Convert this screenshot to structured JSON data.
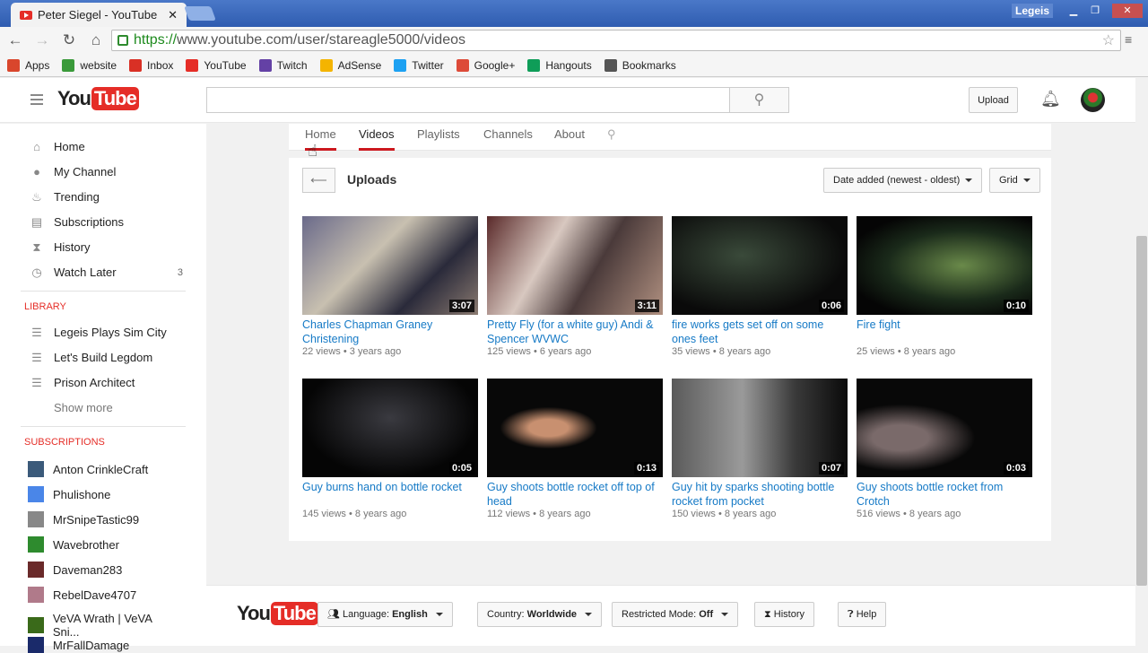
{
  "browser": {
    "tab_title": "Peter Siegel - YouTube",
    "tab_close": "✕",
    "user": "Legeis",
    "url_https": "https://",
    "url_rest": "www.youtube.com/user/stareagle5000/videos",
    "bookmarks": [
      {
        "label": "Apps",
        "icon": "apps-icon",
        "color": "#d9462c"
      },
      {
        "label": "website",
        "icon": "website-icon",
        "color": "#3a9a3a"
      },
      {
        "label": "Inbox",
        "icon": "gmail-icon",
        "color": "#d93025"
      },
      {
        "label": "YouTube",
        "icon": "youtube-icon",
        "color": "#e52d27"
      },
      {
        "label": "Twitch",
        "icon": "twitch-icon",
        "color": "#6441a5"
      },
      {
        "label": "AdSense",
        "icon": "adsense-icon",
        "color": "#f4b400"
      },
      {
        "label": "Twitter",
        "icon": "twitter-icon",
        "color": "#1da1f2"
      },
      {
        "label": "Google+",
        "icon": "googleplus-icon",
        "color": "#dd4b39"
      },
      {
        "label": "Hangouts",
        "icon": "hangouts-icon",
        "color": "#0f9d58"
      },
      {
        "label": "Bookmarks",
        "icon": "star-icon",
        "color": "#555555"
      }
    ]
  },
  "masthead": {
    "logo_you": "You",
    "logo_tube": "Tube",
    "upload": "Upload"
  },
  "sidebar": {
    "nav": [
      {
        "label": "Home",
        "icon": "home-icon",
        "glyph": "⌂"
      },
      {
        "label": "My Channel",
        "icon": "person-icon",
        "glyph": "●"
      },
      {
        "label": "Trending",
        "icon": "flame-icon",
        "glyph": "♨"
      },
      {
        "label": "Subscriptions",
        "icon": "subscriptions-icon",
        "glyph": "▤"
      },
      {
        "label": "History",
        "icon": "hourglass-icon",
        "glyph": "⧗"
      },
      {
        "label": "Watch Later",
        "icon": "clock-icon",
        "glyph": "◷",
        "count": "3"
      }
    ],
    "library_heading": "LIBRARY",
    "library": [
      {
        "label": "Legeis Plays Sim City"
      },
      {
        "label": "Let's Build Legdom"
      },
      {
        "label": "Prison Architect"
      }
    ],
    "show_more": "Show more",
    "subscriptions_heading": "SUBSCRIPTIONS",
    "subscriptions": [
      {
        "label": "Anton CrinkleCraft",
        "color": "#3b5a7a"
      },
      {
        "label": "Phulishone",
        "color": "#4a86e8"
      },
      {
        "label": "MrSnipeTastic99",
        "color": "#888888"
      },
      {
        "label": "Wavebrother",
        "color": "#2e8b2e"
      },
      {
        "label": "Daveman283",
        "color": "#6a2a2a"
      },
      {
        "label": "RebelDave4707",
        "color": "#b07a8a"
      },
      {
        "label": "VeVA Wrath | VeVA Sni...",
        "color": "#3a6a1a"
      },
      {
        "label": "MrFallDamage",
        "color": "#1a2a6a"
      }
    ]
  },
  "channel_tabs": [
    "Home",
    "Videos",
    "Playlists",
    "Channels",
    "About"
  ],
  "uploads": {
    "title": "Uploads",
    "sort": "Date added (newest - oldest)",
    "view": "Grid"
  },
  "videos": [
    {
      "title": "Charles Chapman Graney Christening",
      "views": "22 views",
      "age": "3 years ago",
      "duration": "3:07",
      "bg": "linear-gradient(135deg,#6a6a8a,#c8c0b0 40%,#2a2a3a 70%,#8a7a70)"
    },
    {
      "title": "Pretty Fly (for a white guy) Andi & Spencer WVWC",
      "views": "125 views",
      "age": "6 years ago",
      "duration": "3:11",
      "bg": "linear-gradient(120deg,#5a2a2a,#d8c8c0 35%,#4a3a3a 60%,#b09080)"
    },
    {
      "title": "fire works gets set off on some ones feet",
      "views": "35 views",
      "age": "8 years ago",
      "duration": "0:06",
      "bg": "radial-gradient(ellipse at 40% 40%,#3a4a3a,#0a0a0a 70%)"
    },
    {
      "title": "Fire fight",
      "views": "25 views",
      "age": "8 years ago",
      "duration": "0:10",
      "bg": "radial-gradient(ellipse at 60% 50%,#6a8a4a,#1a2a1a 50%,#050505 80%)"
    },
    {
      "title": "Guy burns hand on bottle rocket",
      "views": "145 views",
      "age": "8 years ago",
      "duration": "0:05",
      "bg": "radial-gradient(ellipse at 50% 40%,#3a3a40,#050505 70%)"
    },
    {
      "title": "Guy shoots bottle rocket off top of head",
      "views": "112 views",
      "age": "8 years ago",
      "duration": "0:13",
      "bg": "radial-gradient(ellipse at 35% 50%,#c89070 0 12%,#080808 30%)"
    },
    {
      "title": "Guy hit by sparks shooting bottle rocket from pocket",
      "views": "150 views",
      "age": "8 years ago",
      "duration": "0:07",
      "bg": "linear-gradient(90deg,#5a5a5a,#9a9a9a 40%,#3a3a3a 70%,#0a0a0a)"
    },
    {
      "title": "Guy shoots bottle rocket from Crotch",
      "views": "516 views",
      "age": "8 years ago",
      "duration": "0:03",
      "bg": "radial-gradient(ellipse at 25% 60%,#7a6a6a 0 15%,#080808 40%)"
    }
  ],
  "footer": {
    "language_label": "Language:",
    "language": "English",
    "country_label": "Country:",
    "country": "Worldwide",
    "restricted_label": "Restricted Mode:",
    "restricted": "Off",
    "history": "History",
    "help": "Help"
  }
}
